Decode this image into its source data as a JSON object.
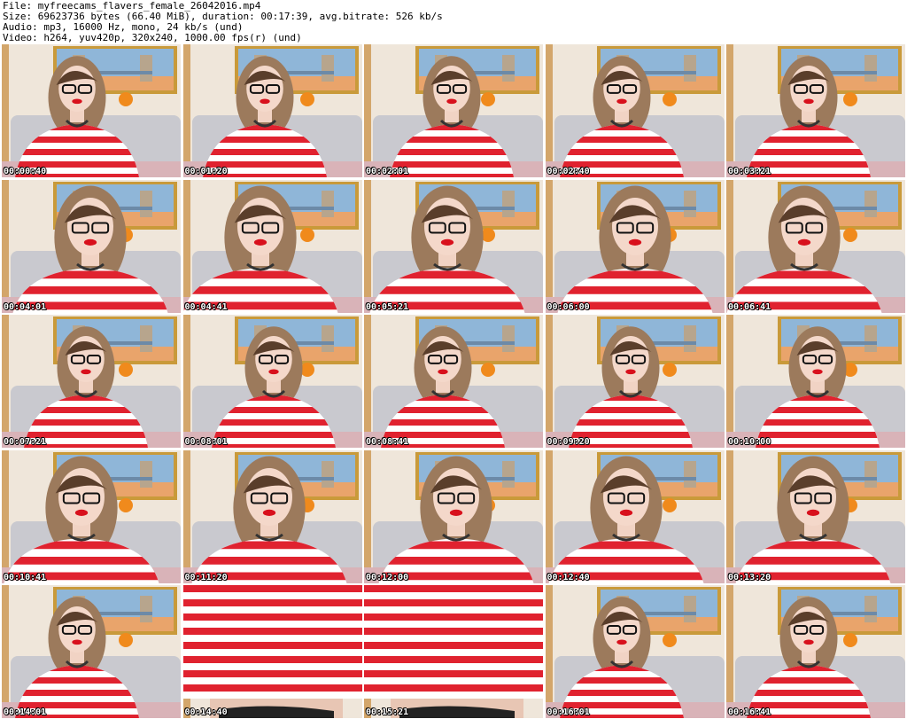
{
  "header": {
    "file_line": "File: myfreecams_flavers_female_26042016.mp4",
    "size_line": "Size: 69623736 bytes (66.40 MiB), duration: 00:17:39, avg.bitrate: 526 kb/s",
    "audio_line": "Audio: mp3, 16000 Hz, mono, 24 kb/s (und)",
    "video_line": "Video: h264, yuv420p, 320x240, 1000.00 fps(r) (und)"
  },
  "colors": {
    "stripe_red": "#e0222f",
    "wall": "#efe6da",
    "poster_sky": "#8fb6d8",
    "frame_gold": "#c99a3a",
    "sofa": "#c9c9cf",
    "hair": "#9c7a5c"
  },
  "thumbnails": [
    {
      "timestamp": "00:00:40",
      "variant": "portrait"
    },
    {
      "timestamp": "00:01:20",
      "variant": "portrait"
    },
    {
      "timestamp": "00:02:01",
      "variant": "portrait"
    },
    {
      "timestamp": "00:02:40",
      "variant": "portrait"
    },
    {
      "timestamp": "00:03:21",
      "variant": "portrait"
    },
    {
      "timestamp": "00:04:01",
      "variant": "closeup"
    },
    {
      "timestamp": "00:04:41",
      "variant": "closeup"
    },
    {
      "timestamp": "00:05:21",
      "variant": "closeup"
    },
    {
      "timestamp": "00:06:00",
      "variant": "closeup"
    },
    {
      "timestamp": "00:06:41",
      "variant": "closeup"
    },
    {
      "timestamp": "00:07:21",
      "variant": "portrait"
    },
    {
      "timestamp": "00:08:01",
      "variant": "portrait"
    },
    {
      "timestamp": "00:08:41",
      "variant": "portrait"
    },
    {
      "timestamp": "00:09:20",
      "variant": "portrait"
    },
    {
      "timestamp": "00:10:00",
      "variant": "portrait"
    },
    {
      "timestamp": "00:10:41",
      "variant": "closeup"
    },
    {
      "timestamp": "00:11:20",
      "variant": "closeup"
    },
    {
      "timestamp": "00:12:00",
      "variant": "closeup"
    },
    {
      "timestamp": "00:12:40",
      "variant": "closeup"
    },
    {
      "timestamp": "00:13:20",
      "variant": "closeup"
    },
    {
      "timestamp": "00:14:01",
      "variant": "portrait"
    },
    {
      "timestamp": "00:14:40",
      "variant": "torso"
    },
    {
      "timestamp": "00:15:21",
      "variant": "torso"
    },
    {
      "timestamp": "00:16:01",
      "variant": "portrait"
    },
    {
      "timestamp": "00:16:41",
      "variant": "portrait"
    }
  ]
}
